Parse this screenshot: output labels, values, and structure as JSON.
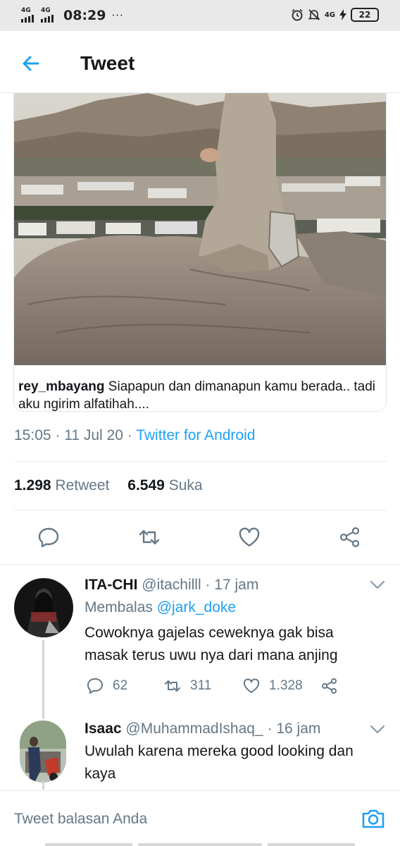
{
  "status_bar": {
    "sim1": "4G",
    "sim2": "4G",
    "time": "08:29",
    "more": "···",
    "net_right": "4G",
    "battery": "22"
  },
  "header": {
    "title": "Tweet"
  },
  "media": {
    "caption_user": "rey_mbayang",
    "caption_text": " Siapapun dan dimanapun kamu berada.. tadi aku ngirim alfatihah...."
  },
  "tweet_meta": {
    "time": "15:05",
    "sep1": " · ",
    "date": "11 Jul 20",
    "sep2": " · ",
    "source": "Twitter for Android"
  },
  "stats": {
    "retweets": "1.298",
    "retweets_label": "Retweet",
    "likes": "6.549",
    "likes_label": "Suka"
  },
  "replies": [
    {
      "name": "ITA-CHI",
      "handle": "@itachilll",
      "time": "· 17 jam",
      "replying_label": "Membalas ",
      "replying_to": "@jark_doke",
      "text": "Cowoknya gajelas ceweknya gak bisa masak terus uwu nya dari mana anjing",
      "comments": "62",
      "retweets": "311",
      "likes": "1.328"
    },
    {
      "name": "Isaac",
      "handle": "@MuhammadIshaq_",
      "time": "· 16 jam",
      "text": "Uwulah karena mereka good looking dan kaya"
    }
  ],
  "compose": {
    "placeholder": "Tweet balasan Anda"
  },
  "colors": {
    "accent": "#1da1f2",
    "muted": "#657786",
    "text": "#14171a",
    "border": "#e6ecf0"
  },
  "icons": [
    "back-arrow-icon",
    "reply-icon",
    "retweet-icon",
    "like-icon",
    "share-icon",
    "chevron-down-icon",
    "camera-icon",
    "alarm-icon",
    "mute-icon",
    "charging-icon"
  ]
}
